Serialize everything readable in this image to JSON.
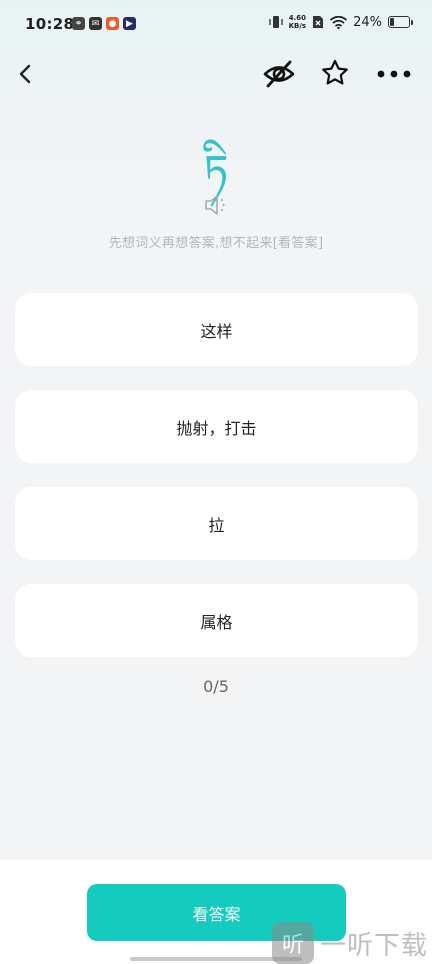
{
  "status_bar": {
    "time": "10:28",
    "net_speed_value": "4.60",
    "net_speed_unit": "KB/s",
    "battery_percent": "24%",
    "battery_level": 0.24
  },
  "nav": {
    "back_icon": "chevron-left-icon",
    "hide_icon": "eye-off-icon",
    "favorite_icon": "star-outline-icon",
    "more_icon": "more-horizontal-icon"
  },
  "word": {
    "text": "ཏི",
    "hint": "先想词义再想答案,想不起来[看答案]",
    "speaker_icon": "speaker-icon"
  },
  "options": [
    {
      "label": "这样"
    },
    {
      "label": "抛射，打击"
    },
    {
      "label": "拉"
    },
    {
      "label": "属格"
    }
  ],
  "progress": {
    "text": "0/5",
    "current": 0,
    "total": 5
  },
  "footer": {
    "show_answer_label": "看答案"
  },
  "watermark": {
    "logo_text": "听",
    "text": "一听下载"
  },
  "colors": {
    "accent": "#15cbbd",
    "word_color": "#35c2c8",
    "background": "#f3f4f6"
  }
}
